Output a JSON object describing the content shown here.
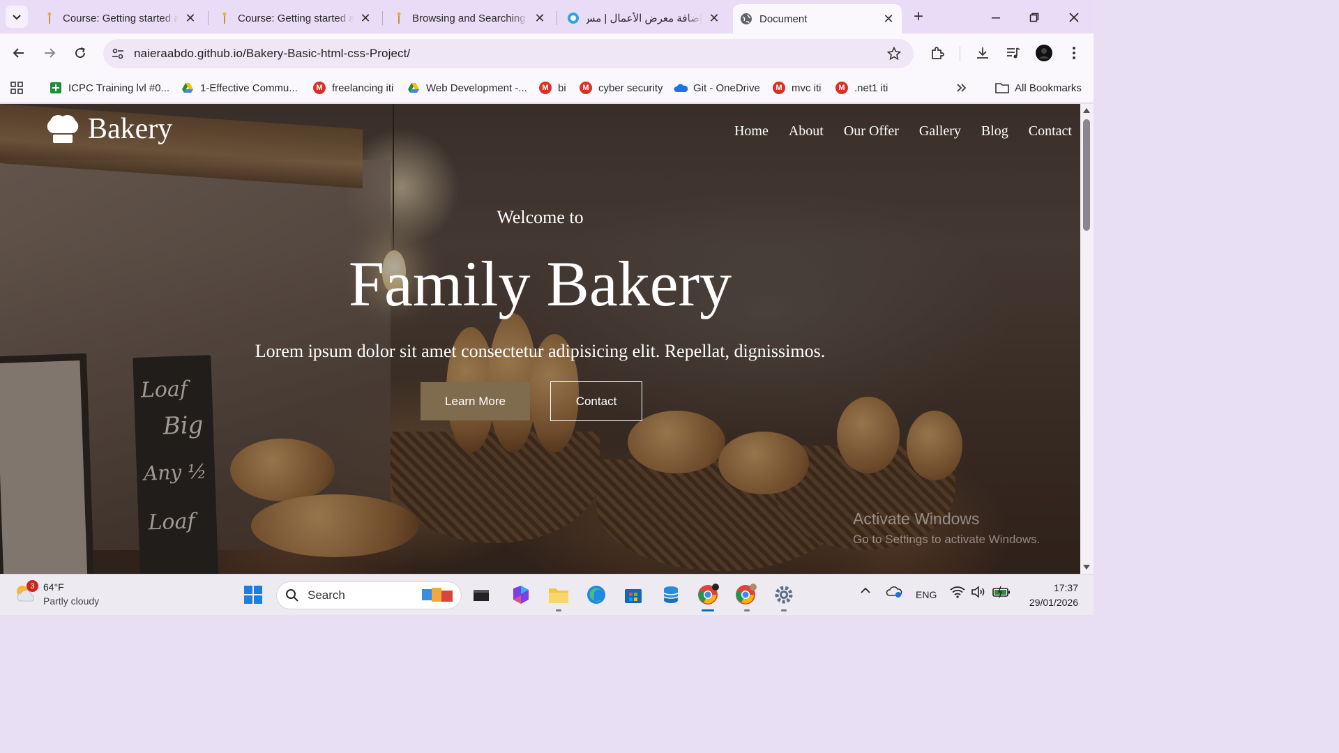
{
  "tabs": [
    {
      "title": "Course: Getting started a",
      "active": false
    },
    {
      "title": "Course: Getting started a",
      "active": false
    },
    {
      "title": "Browsing and Searching",
      "active": false
    },
    {
      "title": "إضافة معرض الأعمال | مس",
      "active": false
    },
    {
      "title": "Document",
      "active": true
    }
  ],
  "toolbar": {
    "url": "naieraabdo.github.io/Bakery-Basic-html-css-Project/"
  },
  "bookmarks": [
    {
      "label": "ICPC Training lvl #0...",
      "icon": "sheets-icon"
    },
    {
      "label": "1-Effective Commu...",
      "icon": "drive-icon"
    },
    {
      "label": "freelancing iti",
      "icon": "gmail-icon"
    },
    {
      "label": "Web Development -...",
      "icon": "drive-icon"
    },
    {
      "label": "bi",
      "icon": "gmail-icon"
    },
    {
      "label": "cyber security",
      "icon": "gmail-icon"
    },
    {
      "label": "Git - OneDrive",
      "icon": "onedrive-icon"
    },
    {
      "label": "mvc iti",
      "icon": "gmail-icon"
    },
    {
      "label": ".net1 iti",
      "icon": "gmail-icon"
    }
  ],
  "all_bookmarks": "All Bookmarks",
  "site": {
    "logo": "Bakery",
    "nav": [
      "Home",
      "About",
      "Our Offer",
      "Gallery",
      "Blog",
      "Contact"
    ],
    "welcome": "Welcome to",
    "title": "Family Bakery",
    "text": "Lorem ipsum dolor sit amet consectetur adipisicing elit. Repellat, dignissimos.",
    "learn_more": "Learn More",
    "contact": "Contact",
    "accent_color": "#7f6c4e"
  },
  "watermark": {
    "line1": "Activate Windows",
    "line2": "Go to Settings to activate Windows."
  },
  "taskbar": {
    "weather_temp": "64°F",
    "weather_desc": "Partly cloudy",
    "weather_badge": "3",
    "search": "Search",
    "lang": "ENG",
    "time": "17:37",
    "date": "29/01/2026"
  }
}
